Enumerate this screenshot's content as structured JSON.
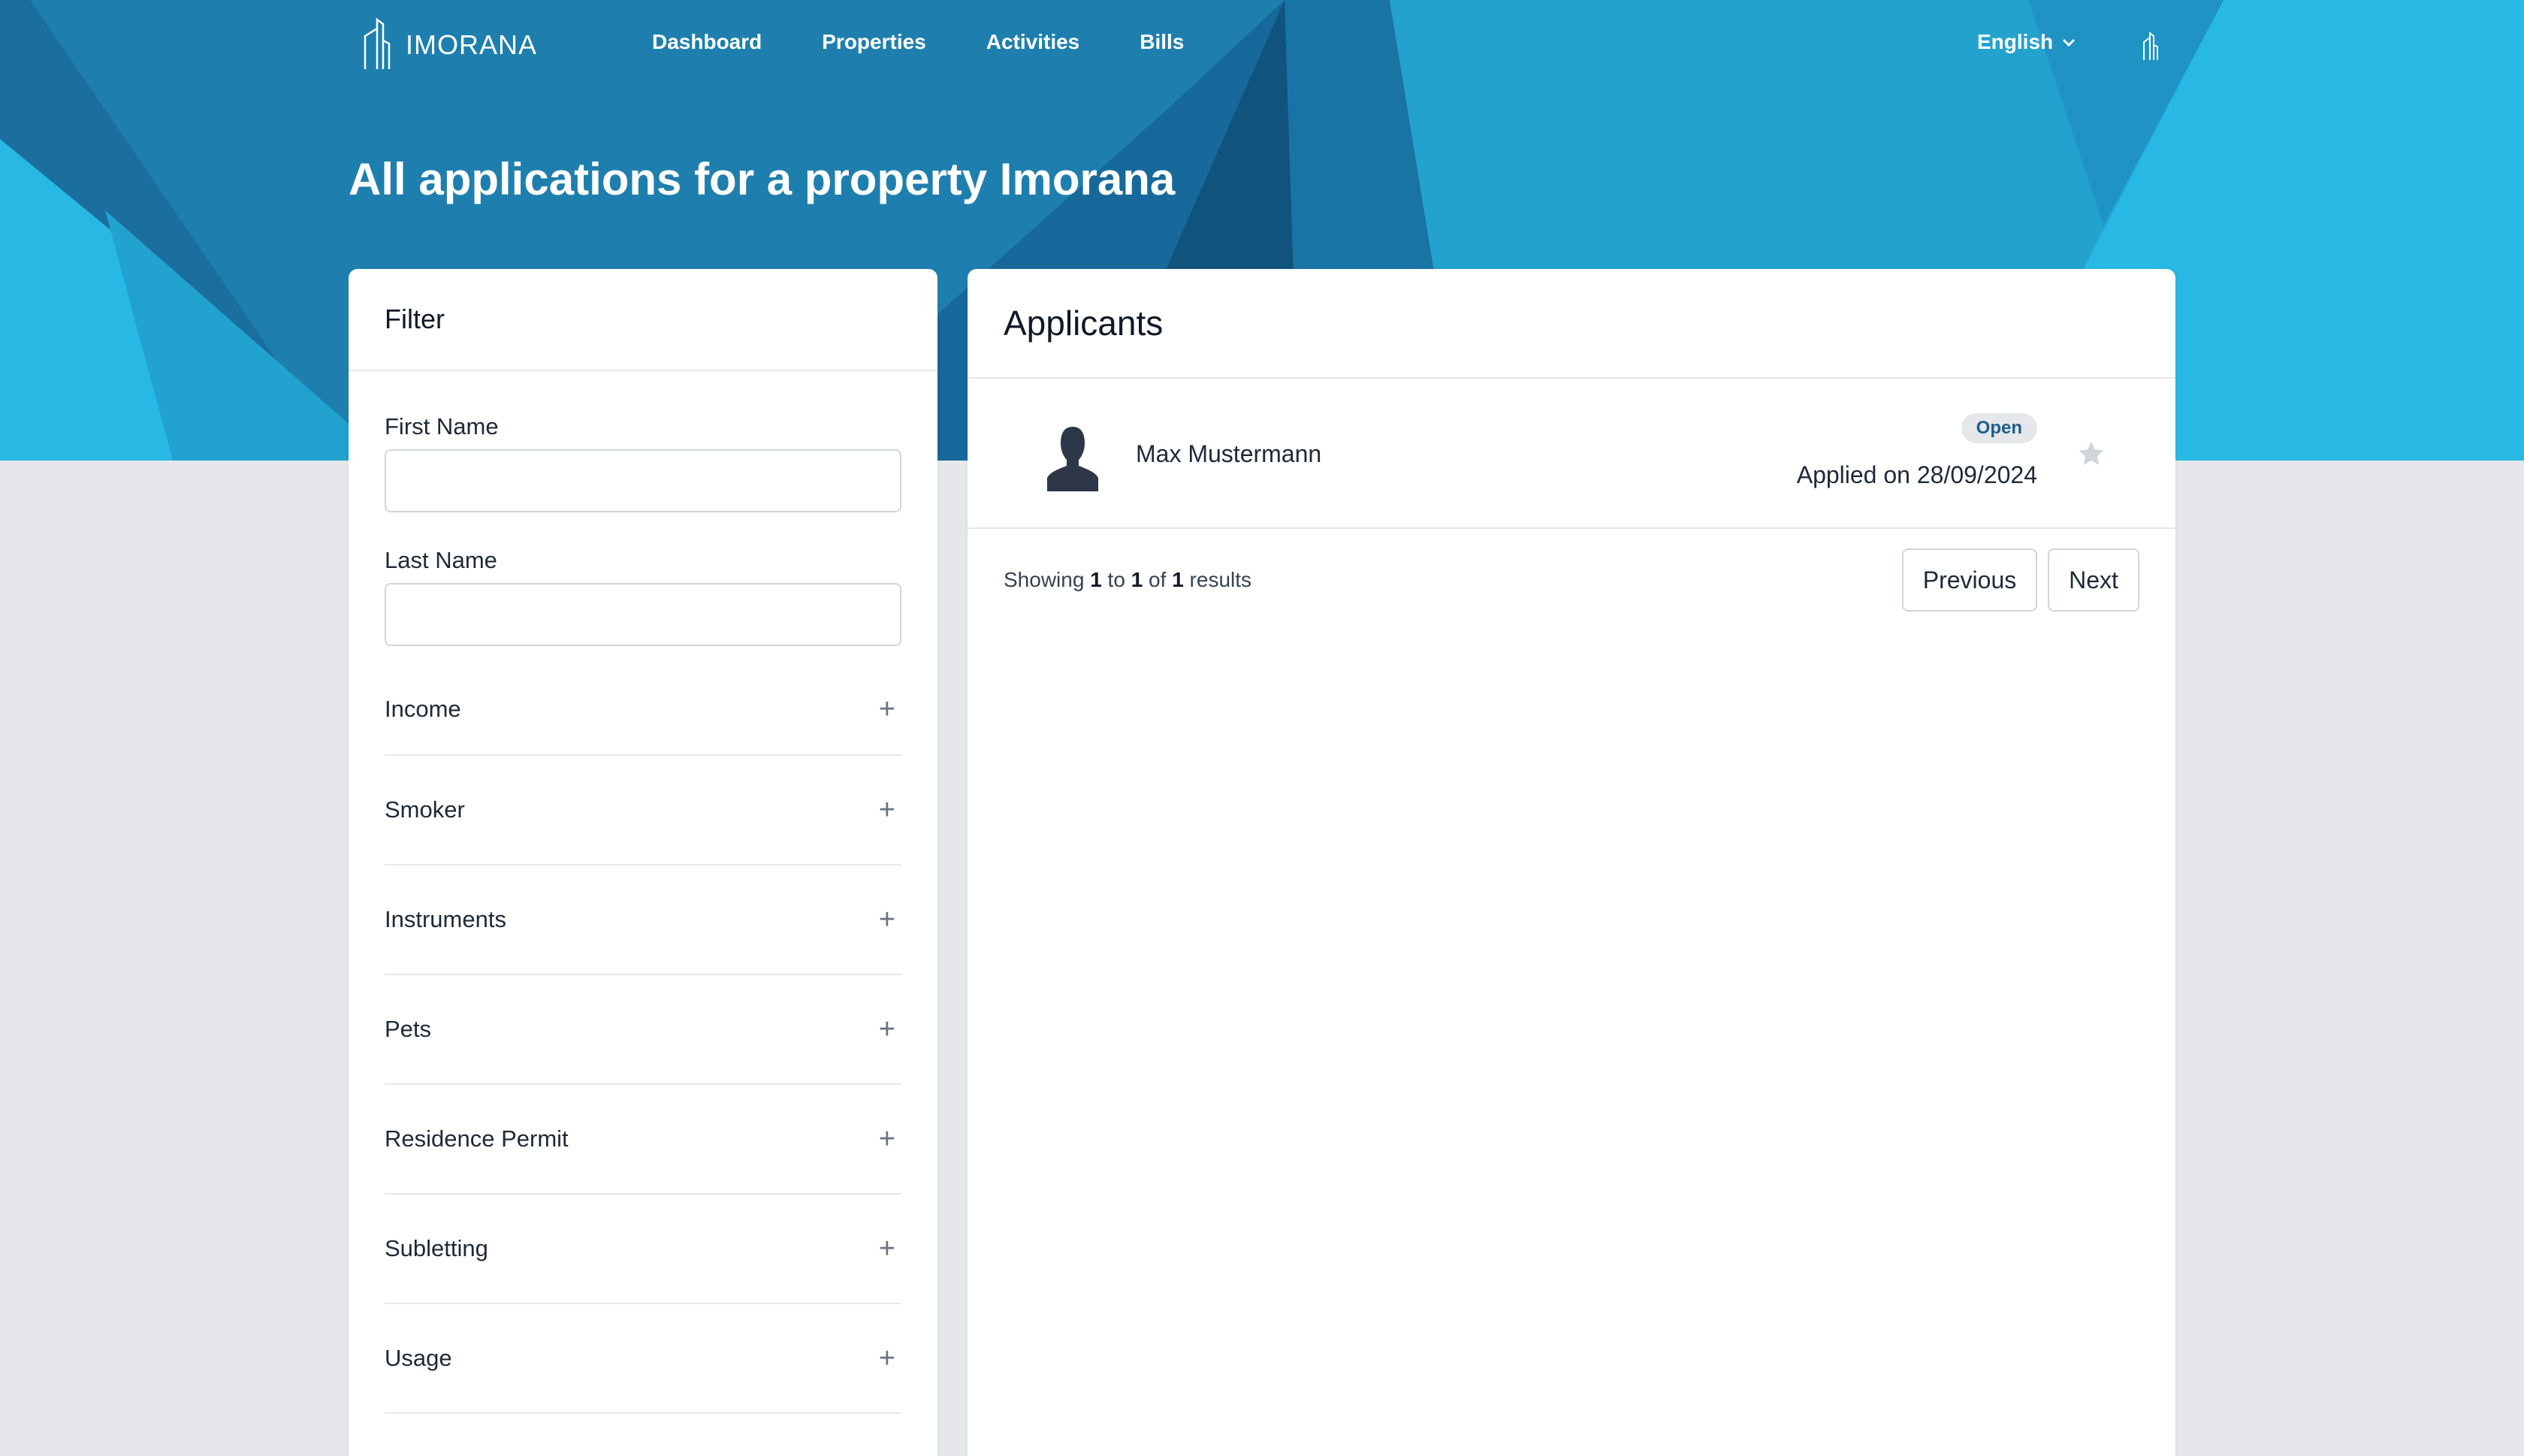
{
  "brand": {
    "name": "IMORANA"
  },
  "nav": {
    "links": [
      {
        "label": "Dashboard"
      },
      {
        "label": "Properties"
      },
      {
        "label": "Activities"
      },
      {
        "label": "Bills"
      }
    ],
    "language": "English"
  },
  "page": {
    "title": "All applications for a property Imorana"
  },
  "filter": {
    "title": "Filter",
    "first_name_label": "First Name",
    "first_name_value": "",
    "last_name_label": "Last Name",
    "last_name_value": "",
    "sections": [
      {
        "label": "Income"
      },
      {
        "label": "Smoker"
      },
      {
        "label": "Instruments"
      },
      {
        "label": "Pets"
      },
      {
        "label": "Residence Permit"
      },
      {
        "label": "Subletting"
      },
      {
        "label": "Usage"
      }
    ],
    "expand_symbol": "+"
  },
  "applicants": {
    "title": "Applicants",
    "items": [
      {
        "name": "Max Mustermann",
        "status": "Open",
        "applied": "Applied on 28/09/2024"
      }
    ],
    "pagination": {
      "showing_prefix": "Showing",
      "from": "1",
      "to_word": "to",
      "to": "1",
      "of_word": "of",
      "total": "1",
      "results_word": "results",
      "previous": "Previous",
      "next": "Next"
    }
  },
  "colors": {
    "hero_base": "#1e7fae",
    "hero_light": "#27b9e3",
    "hero_dark": "#10547d",
    "page_bg": "#e5e7eb"
  }
}
